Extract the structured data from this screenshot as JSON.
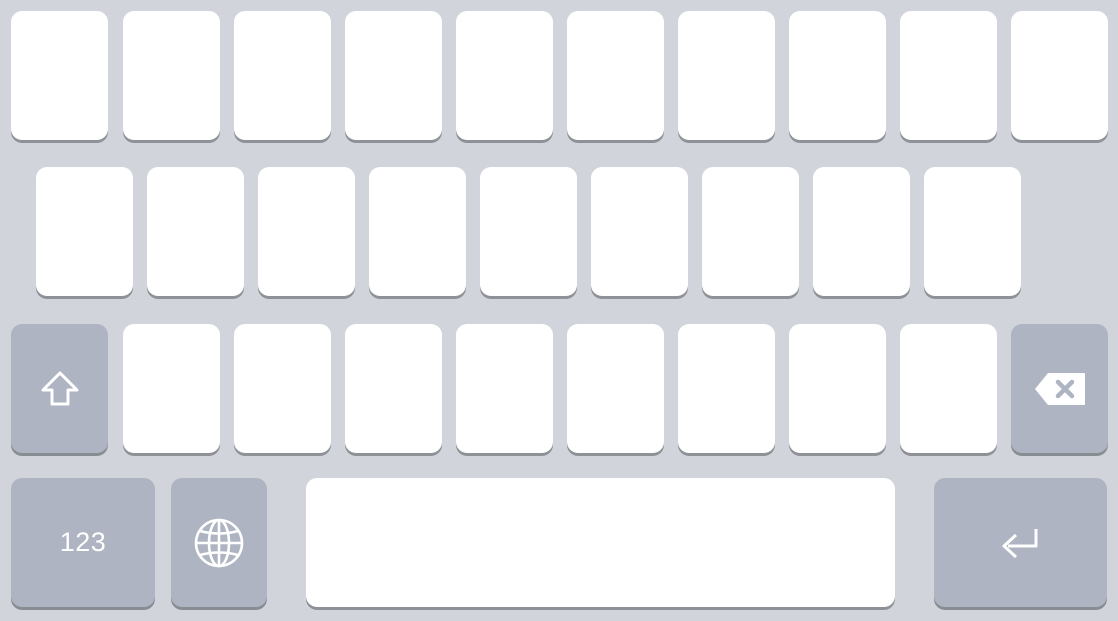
{
  "keyboard": {
    "numbers_key_label": "123",
    "colors": {
      "background": "#d1d4db",
      "letter_key": "#ffffff",
      "function_key": "#aeb4c1",
      "icon": "#ffffff"
    },
    "rows": [
      {
        "keys": 10,
        "type": "letters"
      },
      {
        "keys": 9,
        "type": "letters"
      },
      {
        "keys": 8,
        "type": "letters",
        "left": "shift-icon",
        "right": "backspace-icon"
      },
      {
        "keys": [
          "numbers-key",
          "globe-icon",
          "space-bar",
          "return-icon"
        ]
      }
    ]
  }
}
